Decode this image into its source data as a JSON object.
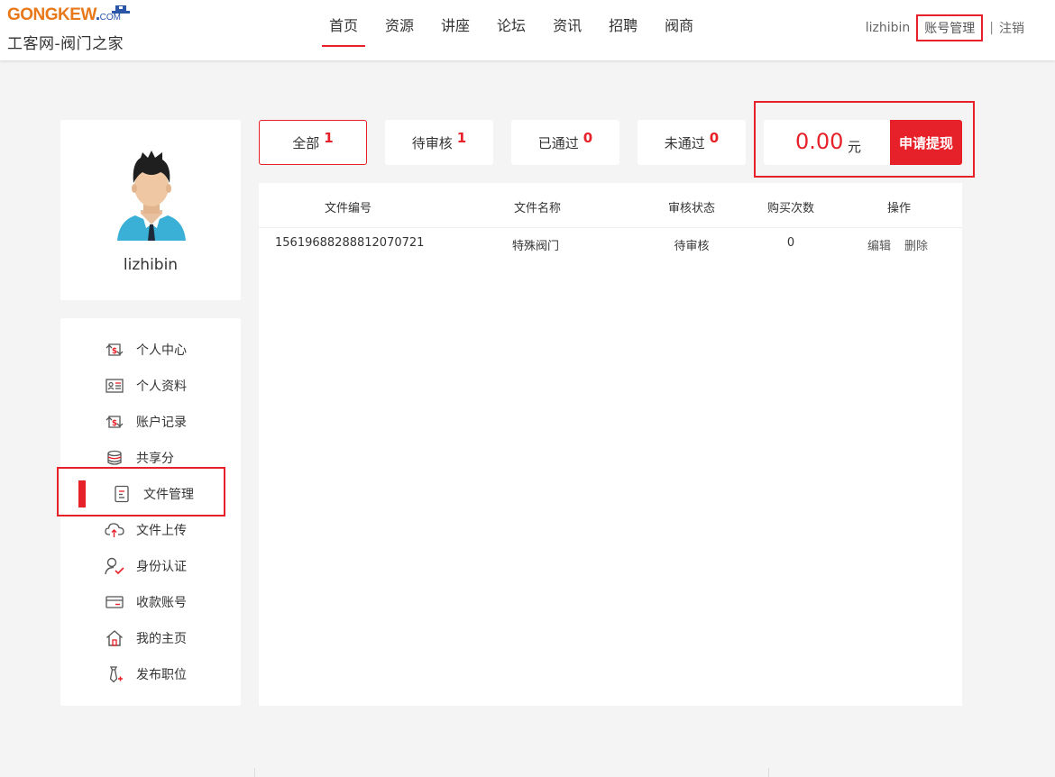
{
  "header": {
    "logo_main_a": "GONGKEW",
    "logo_main_b": ".",
    "logo_com": "COM",
    "logo_sub": "工客网-阀门之家",
    "nav": [
      {
        "label": "首页",
        "active": true
      },
      {
        "label": "资源"
      },
      {
        "label": "讲座"
      },
      {
        "label": "论坛"
      },
      {
        "label": "资讯"
      },
      {
        "label": "招聘"
      },
      {
        "label": "阀商"
      }
    ],
    "username": "lizhibin",
    "account_manage": "账号管理",
    "separator": "|",
    "logout": "注销"
  },
  "profile": {
    "name": "lizhibin"
  },
  "menu": {
    "items": [
      {
        "label": "个人中心",
        "icon": "dollar-cycle-icon"
      },
      {
        "label": "个人资料",
        "icon": "id-card-icon"
      },
      {
        "label": "账户记录",
        "icon": "dollar-cycle-icon"
      },
      {
        "label": "共享分",
        "icon": "coin-stack-icon"
      },
      {
        "label": "文件管理",
        "icon": "document-icon",
        "active": true
      },
      {
        "label": "文件上传",
        "icon": "cloud-upload-icon"
      },
      {
        "label": "身份认证",
        "icon": "user-check-icon"
      },
      {
        "label": "收款账号",
        "icon": "card-icon"
      },
      {
        "label": "我的主页",
        "icon": "home-icon"
      },
      {
        "label": "发布职位",
        "icon": "tie-plus-icon"
      }
    ]
  },
  "tabs": [
    {
      "label": "全部",
      "count": "1",
      "active": true
    },
    {
      "label": "待审核",
      "count": "1"
    },
    {
      "label": "已通过",
      "count": "0"
    },
    {
      "label": "未通过",
      "count": "0"
    }
  ],
  "balance": {
    "amount": "0.00",
    "unit": "元",
    "withdraw_label": "申请提现"
  },
  "table": {
    "headers": [
      "文件编号",
      "文件名称",
      "审核状态",
      "购买次数",
      "操作"
    ],
    "rows": [
      {
        "id": "15619688288812070721",
        "name": "特殊阀门",
        "status": "待审核",
        "purchases": "0",
        "edit": "编辑",
        "delete": "删除"
      }
    ]
  },
  "colors": {
    "accent": "#e62129",
    "logo_orange": "#e8791b",
    "logo_blue": "#2b56a8"
  }
}
